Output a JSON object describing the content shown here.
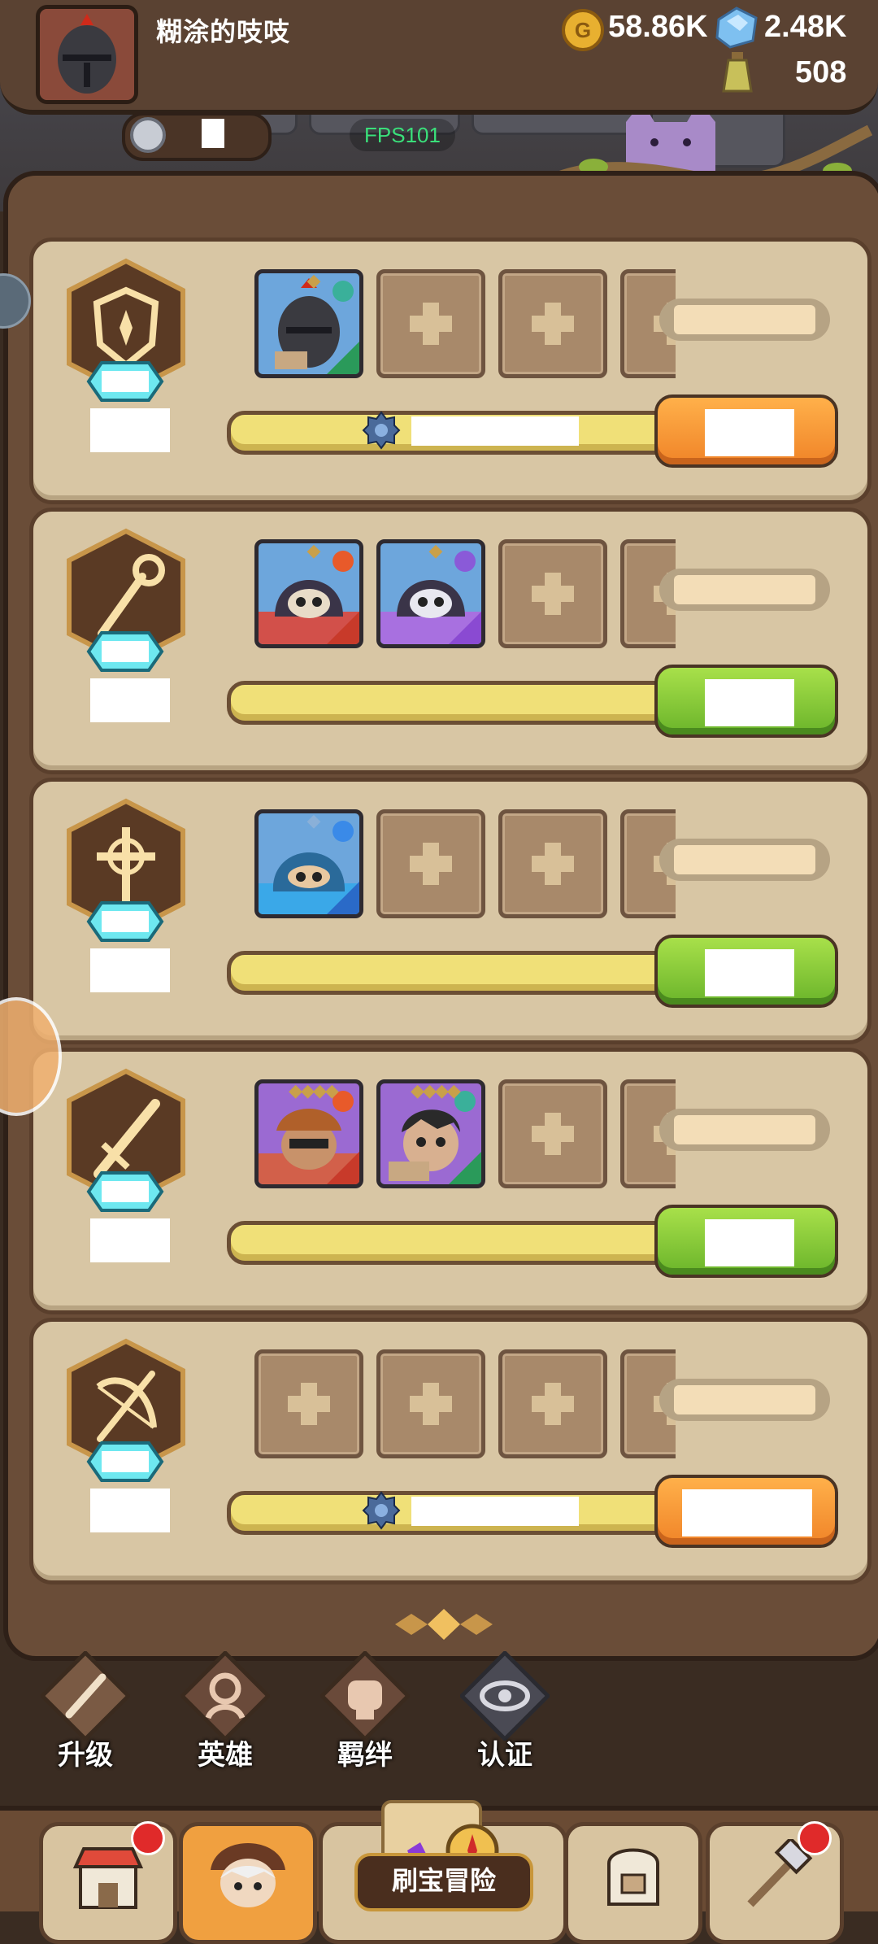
{
  "header": {
    "player_name": "糊涂的吱吱",
    "gold": "58.86K",
    "gems": "2.48K",
    "potion": "508",
    "fps": "FPS101"
  },
  "teams": [
    {
      "emblem": "shield-emblem-icon",
      "action_color": "orange",
      "heroes": [
        {
          "stars": "◆",
          "frame": "blue",
          "element": "wind",
          "role": "shield"
        }
      ],
      "progress_marker": true
    },
    {
      "emblem": "staff-emblem-icon",
      "action_color": "green",
      "heroes": [
        {
          "stars": "◆",
          "frame": "blue",
          "element": "fire",
          "role": "staff"
        },
        {
          "stars": "◆",
          "frame": "blue",
          "element": "moon",
          "role": "staff"
        }
      ],
      "progress_marker": false
    },
    {
      "emblem": "cross-emblem-icon",
      "action_color": "green",
      "heroes": [
        {
          "stars": "◆",
          "frame": "blue",
          "element": "water",
          "role": "cross"
        }
      ],
      "progress_marker": false
    },
    {
      "emblem": "sword-emblem-icon",
      "action_color": "green",
      "heroes": [
        {
          "stars": "◆◆◆◆",
          "frame": "purple",
          "element": "fire",
          "role": "sword"
        },
        {
          "stars": "◆◆◆◆",
          "frame": "purple",
          "element": "wind",
          "role": "sword"
        }
      ],
      "progress_marker": false
    },
    {
      "emblem": "bow-emblem-icon",
      "action_color": "orange",
      "heroes": [],
      "progress_marker": true
    }
  ],
  "nav_tabs": [
    {
      "label": "升级",
      "icon": "sword-upgrade-icon"
    },
    {
      "label": "英雄",
      "icon": "hero-icon"
    },
    {
      "label": "羁绊",
      "icon": "fist-bond-icon"
    },
    {
      "label": "认证",
      "icon": "eye-certify-icon"
    }
  ],
  "dock": {
    "adventure_label": "刷宝冒险",
    "items": [
      "shop-icon",
      "hero-portrait-icon",
      "adventure-icon",
      "backpack-icon",
      "forge-icon"
    ]
  },
  "colors": {
    "orange_button": "#f08428",
    "green_button": "#6ab42a",
    "card": "#d8c6a4",
    "progress": "#f0e078"
  }
}
